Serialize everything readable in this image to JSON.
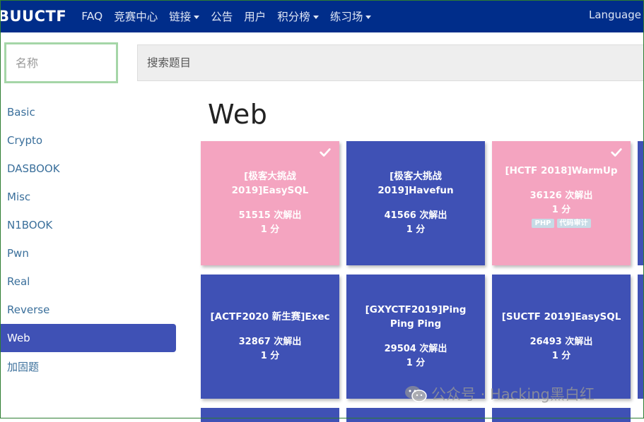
{
  "nav": {
    "brand": "BUUCTF",
    "items": [
      {
        "label": "FAQ",
        "dropdown": false
      },
      {
        "label": "竞赛中心",
        "dropdown": false
      },
      {
        "label": "链接",
        "dropdown": true
      },
      {
        "label": "公告",
        "dropdown": false
      },
      {
        "label": "用户",
        "dropdown": false
      },
      {
        "label": "积分榜",
        "dropdown": true
      },
      {
        "label": "练习场",
        "dropdown": true
      }
    ],
    "language": "Language"
  },
  "filters": {
    "name_placeholder": "名称",
    "search_placeholder": "搜索题目"
  },
  "sidebar": {
    "items": [
      "Basic",
      "Crypto",
      "DASBOOK",
      "Misc",
      "N1BOOK",
      "Pwn",
      "Real",
      "Reverse",
      "Web",
      "加固题"
    ],
    "active": "Web"
  },
  "section": {
    "title": "Web"
  },
  "challenges": [
    {
      "title": "[极客大挑战 2019]EasySQL",
      "solves": "51515 次解出",
      "points": "1 分",
      "solved": true,
      "tags": []
    },
    {
      "title": "[极客大挑战 2019]Havefun",
      "solves": "41566 次解出",
      "points": "1 分",
      "solved": false,
      "tags": []
    },
    {
      "title": "[HCTF 2018]WarmUp",
      "solves": "36126 次解出",
      "points": "1 分",
      "solved": true,
      "tags": [
        "PHP",
        "代码审计"
      ]
    },
    {
      "title": "[ACTF2020 新生赛]Exec",
      "solves": "32867 次解出",
      "points": "1 分",
      "solved": false,
      "tags": []
    },
    {
      "title": "[GXYCTF2019]Ping Ping Ping",
      "solves": "29504 次解出",
      "points": "1 分",
      "solved": false,
      "tags": []
    },
    {
      "title": "[SUCTF 2019]EasySQL",
      "solves": "26493 次解出",
      "points": "1 分",
      "solved": false,
      "tags": []
    }
  ],
  "watermark": {
    "text": "公众号 · Hacking黑白红"
  },
  "colors": {
    "navbar": "#002d8a",
    "solved": "#f4a4c0",
    "unsolved": "#3f51b5",
    "sidebar_active": "#3f51b5"
  }
}
